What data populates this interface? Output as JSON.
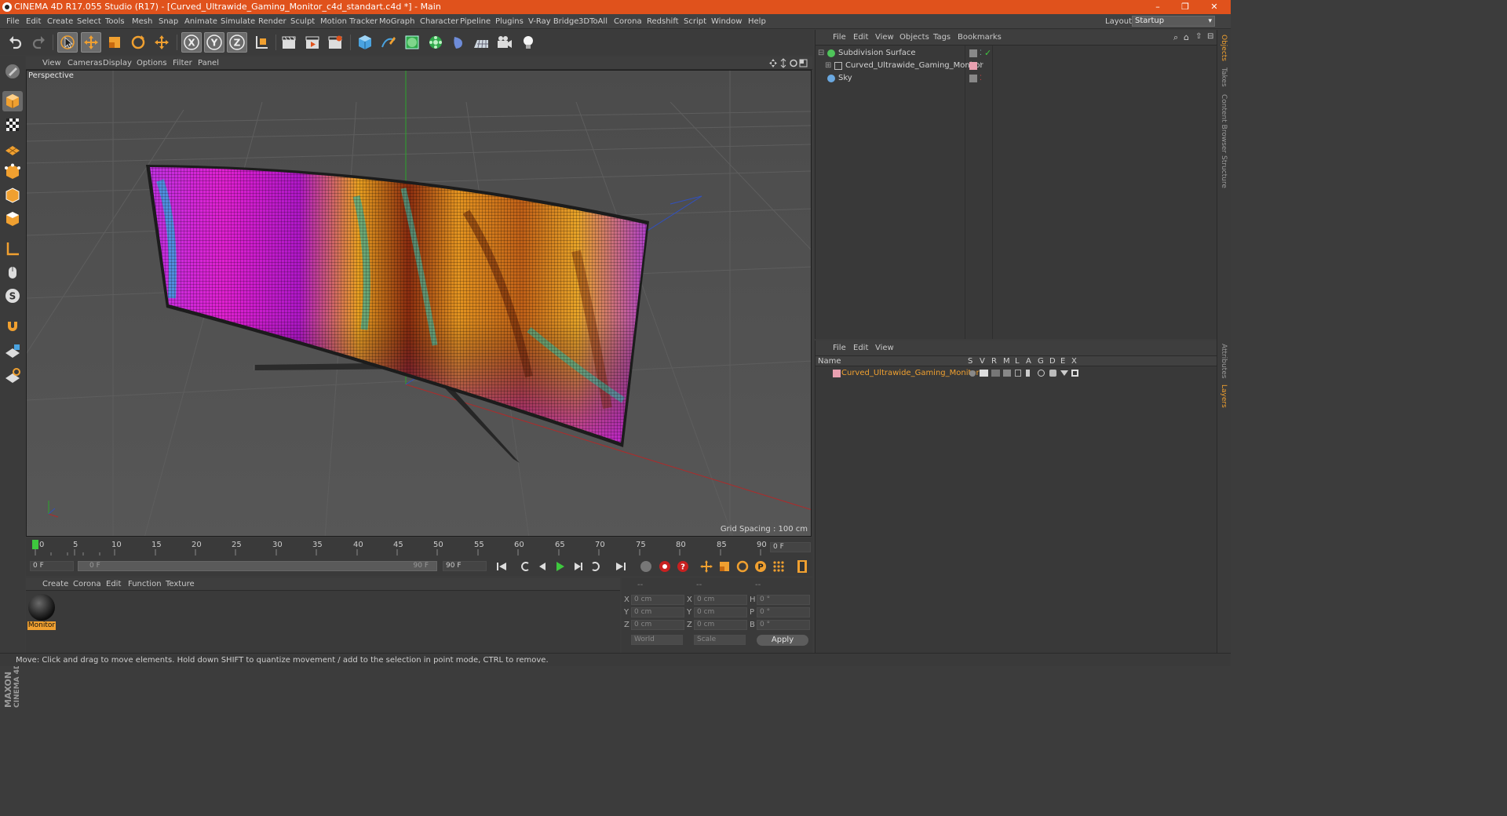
{
  "window": {
    "title": "CINEMA 4D R17.055 Studio (R17) - [Curved_Ultrawide_Gaming_Monitor_c4d_standart.c4d *] - Main",
    "minimize": "–",
    "restore": "❐",
    "close": "✕"
  },
  "menubar": {
    "items": [
      "File",
      "Edit",
      "Create",
      "Select",
      "Tools",
      "Mesh",
      "Snap",
      "Animate",
      "Simulate",
      "Render",
      "Sculpt",
      "Motion Tracker",
      "MoGraph",
      "Character",
      "Pipeline",
      "Plugins",
      "V-Ray Bridge",
      "3DToAll",
      "Corona",
      "Redshift",
      "Script",
      "Window",
      "Help"
    ],
    "layout_label": "Layout:",
    "layout_value": "Startup"
  },
  "viewport": {
    "menu": [
      "View",
      "Cameras",
      "Display",
      "Options",
      "Filter",
      "Panel"
    ],
    "label": "Perspective",
    "grid_spacing": "Grid Spacing : 100 cm"
  },
  "timeline": {
    "ticks": [
      "0",
      "5",
      "10",
      "15",
      "20",
      "25",
      "30",
      "35",
      "40",
      "45",
      "50",
      "55",
      "60",
      "65",
      "70",
      "75",
      "80",
      "85",
      "90"
    ],
    "current_frame": "0 F",
    "start_field": "0 F",
    "range_start": "0 F",
    "range_end": "90 F",
    "end_field": "90 F"
  },
  "material": {
    "menu": [
      "Create",
      "Corona",
      "Edit",
      "Function",
      "Texture"
    ],
    "name": "Monitor"
  },
  "coords": {
    "headers": [
      "--",
      "--",
      "--"
    ],
    "rows": [
      {
        "a": "X",
        "av": "0 cm",
        "b": "X",
        "bv": "0 cm",
        "c": "H",
        "cv": "0 °"
      },
      {
        "a": "Y",
        "av": "0 cm",
        "b": "Y",
        "bv": "0 cm",
        "c": "P",
        "cv": "0 °"
      },
      {
        "a": "Z",
        "av": "0 cm",
        "b": "Z",
        "bv": "0 cm",
        "c": "B",
        "cv": "0 °"
      }
    ],
    "mode": "World",
    "scale": "Scale",
    "apply": "Apply"
  },
  "objects": {
    "menu": [
      "File",
      "Edit",
      "View",
      "Objects",
      "Tags",
      "Bookmarks"
    ],
    "items": [
      {
        "name": "Subdivision Surface"
      },
      {
        "name": "Curved_Ultrawide_Gaming_Monitor"
      },
      {
        "name": "Sky"
      }
    ]
  },
  "layers": {
    "menu": [
      "File",
      "Edit",
      "View"
    ],
    "header_name": "Name",
    "columns": [
      "S",
      "V",
      "R",
      "M",
      "L",
      "A",
      "G",
      "D",
      "E",
      "X"
    ],
    "items": [
      {
        "name": "Curved_Ultrawide_Gaming_Monitor"
      }
    ]
  },
  "right_tabs": [
    "Objects",
    "Takes",
    "Content Browser",
    "Structure",
    "Attributes",
    "Layers"
  ],
  "status": "Move: Click and drag to move elements. Hold down SHIFT to quantize movement / add to the selection in point mode, CTRL to remove.",
  "brand": {
    "line1": "MAXON",
    "line2": "CINEMA 4D"
  },
  "colors": {
    "titlebar": "#e0521c",
    "accent": "#f0a030",
    "selection": "#ff9a00"
  }
}
